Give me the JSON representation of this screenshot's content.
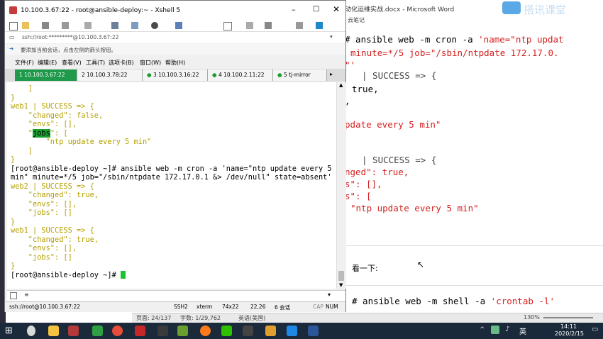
{
  "xshell": {
    "title": "10.100.3.67:22 - root@ansible-deploy:~ - Xshell 5",
    "address": "ssh://root:*********@10.100.3.67:22",
    "hint": "要添加当前会话，点击左侧的箭头按钮。",
    "menu": [
      "文件(F)",
      "编辑(E)",
      "查看(V)",
      "工具(T)",
      "选项卡(B)",
      "窗口(W)",
      "帮助(H)"
    ],
    "tabs": [
      "1 10.100.3.67:22",
      "2 10.100.3.78:22",
      "3 10.100.3.16:22",
      "4 10.100.2.11:22",
      "5 tj-mirror"
    ],
    "terminal": {
      "line1": "    ]",
      "line2": "}",
      "line3": "web1 | SUCCESS => {",
      "line4": "    \"changed\": false,",
      "line5": "    \"envs\": [],",
      "line6_pre": "    \"",
      "line6_highlight": "jobs",
      "line6_post": "\": [",
      "line7": "        \"ntp update every 5 min\"",
      "line8": "    ]",
      "line9": "}",
      "line10": "[root@ansible-deploy ~]# ansible web -m cron -a 'name=\"ntp update every 5",
      "line11": "min\" minute=*/5 job=\"/sbin/ntpdate 172.17.0.1 &> /dev/null\" state=absent'",
      "line12": "web2 | SUCCESS => {",
      "line13": "    \"changed\": true,",
      "line14": "    \"envs\": [],",
      "line15": "    \"jobs\": []",
      "line16": "}",
      "line17": "web1 | SUCCESS => {",
      "line18": "    \"changed\": true,",
      "line19": "    \"envs\": [],",
      "line20": "    \"jobs\": []",
      "line21": "}",
      "line22": "[root@ansible-deploy ~]# "
    },
    "status": {
      "connection": "ssh://root@10.100.3.67:22",
      "protocol": "SSH2",
      "term": "xterm",
      "size": "74x22",
      "cursor": "22,26",
      "sessions": "6 会话",
      "cap": "CAP",
      "num": "NUM"
    }
  },
  "word": {
    "title": "动化运维实战.docx - Microsoft Word",
    "subtitle": "云笔记",
    "lines": {
      "l1a": "# ansible web -m cron -a ",
      "l1b": "'name=\"ntp updat",
      "l2": "minute=*/5 job=\"/sbin/ntpdate 172.17.0.",
      "l3": "\"'",
      "l4": "| SUCCESS => {",
      "l5": "true,",
      "l6": ",",
      "l7": "pdate every 5 min\"",
      "l8": "| SUCCESS => {",
      "l9": "nged\": true,",
      "l10": "s\": [],",
      "l11": "s\": [",
      "l12": "\"ntp update every 5 min\"",
      "l13": "看一下:",
      "l14a": "# ansible web -m shell -a ",
      "l14b": "'crontab -l'"
    },
    "status": {
      "page": "页面: 24/137",
      "words": "字数: 1/29,762",
      "lang": "英语(美国)",
      "zoom": "130%"
    },
    "watermark": "搭讯课堂"
  },
  "taskbar": {
    "ime": "英",
    "time": "14:11",
    "date": "2020/2/15"
  },
  "colors": {
    "tab_active": "#1f9a4b",
    "terminal_yellow": "#b5a000",
    "highlight": "#17a02e",
    "word_red": "#d42020"
  }
}
